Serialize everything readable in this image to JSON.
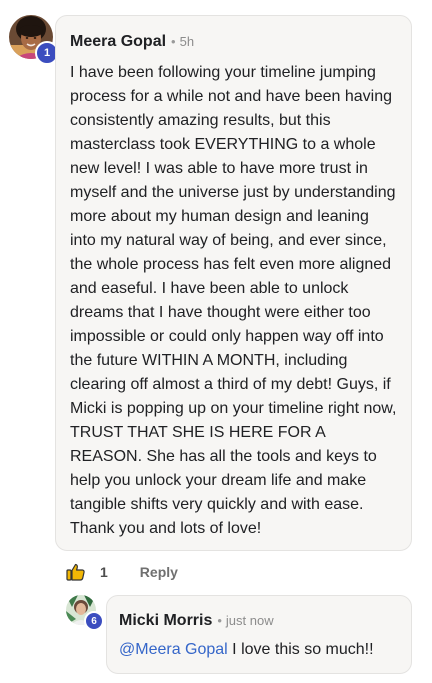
{
  "comment": {
    "author": "Meera Gopal",
    "separator": "•",
    "time": "5h",
    "level": "1",
    "text": "I have been following your timeline jumping process for a while not and have been having consistently amazing results, but this masterclass took EVERYTHING to a whole new level! I was able to have more trust in myself and the universe just by understanding more about my human design and leaning into my natural way of being, and ever since, the whole process has felt even more aligned and easeful. I have been able to unlock dreams that I have thought were either too impossible or could only happen way off into the future WITHIN A MONTH, including clearing off almost a third of my debt! Guys, if Micki is popping up on your timeline right now, TRUST THAT SHE IS HERE FOR A REASON. She has all the tools and keys to help you unlock your dream life and make tangible shifts very quickly and with ease. Thank you and lots of love!",
    "like_icon": "thumbs-up-icon",
    "like_count": "1",
    "reply_label": "Reply"
  },
  "reply": {
    "author": "Micki Morris",
    "separator": "•",
    "time": "just now",
    "level": "6",
    "mention": "@Meera Gopal",
    "text": " I love this so much!!"
  },
  "colors": {
    "badge": "#3b4dbf",
    "like_icon": "#f2b705",
    "mention": "#3566c9",
    "bubble_bg": "#f7f6f4"
  }
}
